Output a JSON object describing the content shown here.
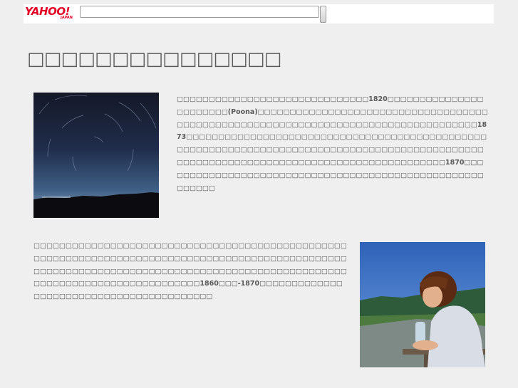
{
  "header": {
    "logo_text": "YAHOO!",
    "logo_subtext": "JAPAN",
    "search_placeholder": "",
    "search_value": ""
  },
  "main": {
    "title": "□□□□□□□□□□□□□□□",
    "section1": {
      "image": "night-sky-star-trails",
      "text": "□□□□□□□□□□□□□□□□□□□□□□□□□□□□□□1820□□□□□□□□□□□□□□□□□□□□□□□(Poona)□□□□□□□□□□□□□□□□□□□□□□□□□□□□□□□□□□□□□□□□□□□□□□□□□□□□□□□□□□□□□□□□□□□□□□□□□□□□□□□□□□□1873□□□□□□□□□□□□□□□□□□□□□□□□□□□□□□□□□□□□□□□□□□□□□□□□□□□□□□□□□□□□□□□□□□□□□□□□□□□□□□□□□□□□□□□□□□□□□□□□□□□□□□□□□□□□□□□□□□□□□□□□□□□□□□□□□□□□□□□□□1870□□□□□□□□□□□□□□□□□□□□□□□□□□□□□□□□□□□□□□□□□□□□□□□□□□□□□□□□□"
    },
    "section2": {
      "image": "woman-holding-water-bottle",
      "text": "□□□□□□□□□□□□□□□□□□□□□□□□□□□□□□□□□□□□□□□□□□□□□□□□□□□□□□□□□□□□□□□□□□□□□□□□□□□□□□□□□□□□□□□□□□□□□□□□□□□□□□□□□□□□□□□□□□□□□□□□□□□□□□□□□□□□□□□□□□□□□□□□□□□□□□□□□□□□□□□□□□□□□□□□□□□□□1860□□□-1870□□□□□□□□□□□□□□□□□□□□□□□□□□□□□□□□□□□□□□□□□"
    }
  },
  "colors": {
    "background": "#efefef",
    "topbar": "#ffffff",
    "logo": "#e30022",
    "title": "#5b5b5b",
    "body_text": "#5a5a5a"
  }
}
